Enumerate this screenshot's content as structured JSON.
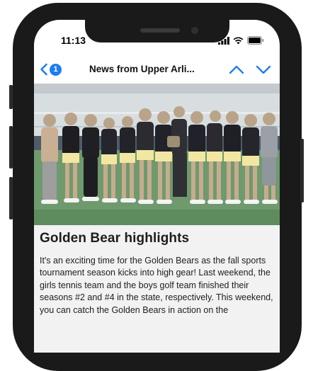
{
  "status": {
    "time": "11:13"
  },
  "nav": {
    "badge": "1",
    "title": "News from Upper Arli..."
  },
  "icons": {
    "back": "chevron-left-icon",
    "up": "chevron-up-icon",
    "down": "chevron-down-icon",
    "signal": "signal-icon",
    "wifi": "wifi-icon",
    "battery": "battery-icon"
  },
  "colors": {
    "accent": "#1e7cf2"
  },
  "article": {
    "title": "Golden Bear highlights",
    "body": "It's an exciting time for the Golden Bears as the fall sports tournament season kicks into high gear! Last weekend, the girls tennis team and the boys golf team finished their seasons #2 and #4 in the state, respectively. This weekend, you can catch the Golden Bears in action on the"
  }
}
